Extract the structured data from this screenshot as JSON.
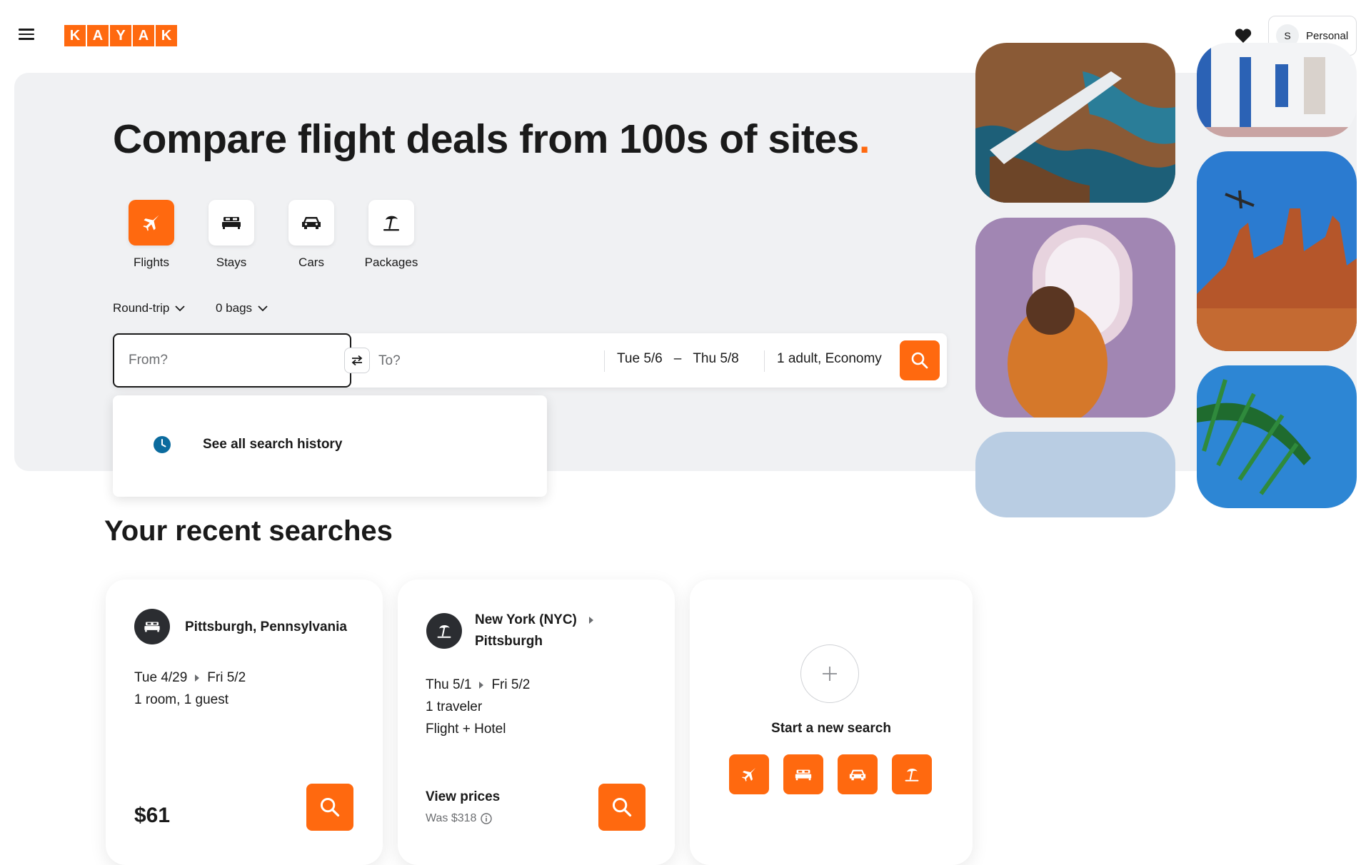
{
  "header": {
    "logo_letters": [
      "K",
      "A",
      "Y",
      "A",
      "K"
    ],
    "account_initial": "S",
    "account_label": "Personal"
  },
  "hero": {
    "title": "Compare flight deals from 100s of sites",
    "title_accent": ".",
    "verticals": [
      {
        "label": "Flights",
        "icon": "plane-icon",
        "active": true
      },
      {
        "label": "Stays",
        "icon": "bed-icon",
        "active": false
      },
      {
        "label": "Cars",
        "icon": "car-icon",
        "active": false
      },
      {
        "label": "Packages",
        "icon": "beach-umbrella-icon",
        "active": false
      }
    ],
    "trip_type": "Round-trip",
    "bags": "0 bags"
  },
  "search": {
    "from_placeholder": "From?",
    "to_placeholder": "To?",
    "depart_date": "Tue 5/6",
    "date_separator": "–",
    "return_date": "Thu 5/8",
    "travelers": "1 adult, Economy"
  },
  "history": {
    "label": "See all search history"
  },
  "recent": {
    "title": "Your recent searches",
    "cards": [
      {
        "type_icon": "bed-icon",
        "title": "Pittsburgh, Pennsylvania",
        "dates_from": "Tue 4/29",
        "dates_to": "Fri 5/2",
        "details": [
          "1 room, 1 guest"
        ],
        "price": "$61"
      },
      {
        "type_icon": "beach-umbrella-icon",
        "origin": "New York (NYC)",
        "destination": "Pittsburgh",
        "dates_from": "Thu 5/1",
        "dates_to": "Fri 5/2",
        "details": [
          "1 traveler",
          "Flight + Hotel"
        ],
        "price_label": "View prices",
        "was_price": "Was $318"
      }
    ],
    "new_search_label": "Start a new search"
  },
  "colors": {
    "accent": "#ff690f",
    "hero_bg": "#f0f1f3",
    "text": "#1a1a1a",
    "history_icon": "#0b6b9e"
  }
}
